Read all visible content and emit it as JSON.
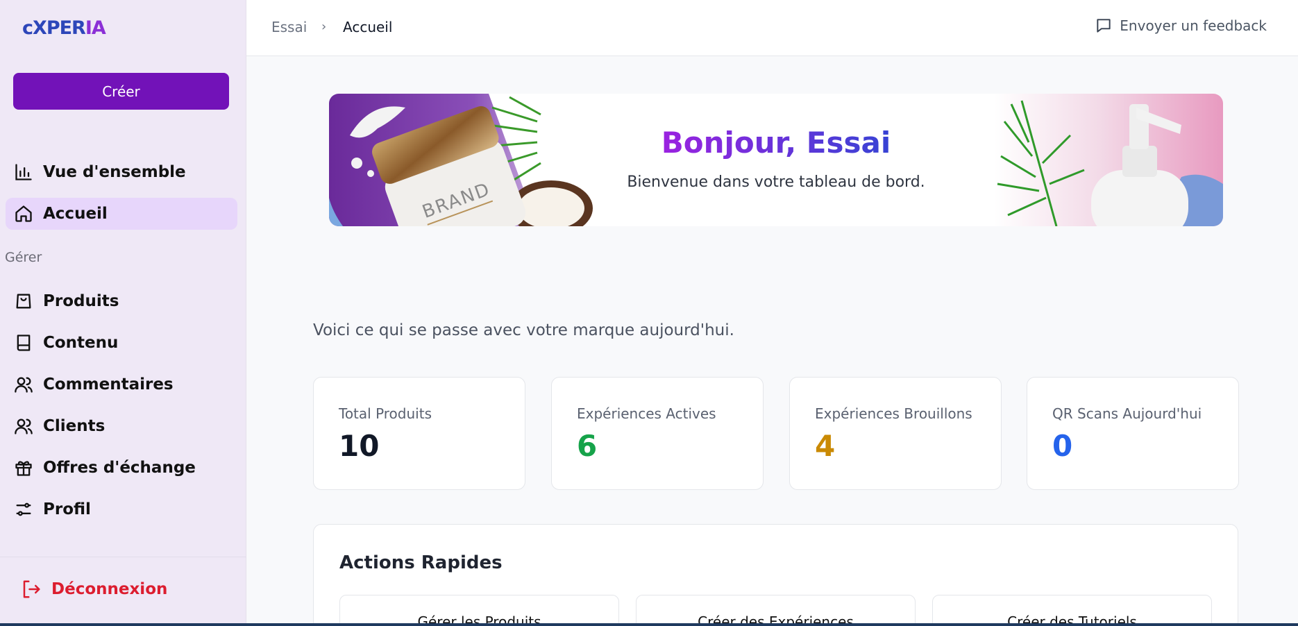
{
  "brand": {
    "logo_part1": "cXPER",
    "logo_part2": "IA"
  },
  "sidebar": {
    "create_label": "Créer",
    "items": [
      {
        "label": "Vue d'ensemble",
        "icon": "bar-chart-icon"
      },
      {
        "label": "Accueil",
        "icon": "home-icon",
        "active": true
      }
    ],
    "section_label": "Gérer",
    "manage_items": [
      {
        "label": "Produits",
        "icon": "shopping-bag-icon"
      },
      {
        "label": "Contenu",
        "icon": "book-icon"
      },
      {
        "label": "Commentaires",
        "icon": "users-icon"
      },
      {
        "label": "Clients",
        "icon": "users-icon"
      },
      {
        "label": "Offres d'échange",
        "icon": "gift-icon"
      },
      {
        "label": "Profil",
        "icon": "sliders-icon"
      }
    ],
    "logout_label": "Déconnexion"
  },
  "header": {
    "breadcrumb": [
      "Essai",
      "Accueil"
    ],
    "breadcrumb_separator": "›",
    "feedback_label": "Envoyer un feedback"
  },
  "banner": {
    "title": "Bonjour, Essai",
    "subtitle": "Bienvenue dans votre tableau de bord.",
    "jar_text": "BRAND"
  },
  "intro": "Voici ce qui se passe avec votre marque aujourd'hui.",
  "stats": [
    {
      "label": "Total Produits",
      "value": "10",
      "color": "#111827"
    },
    {
      "label": "Expériences Actives",
      "value": "6",
      "color": "#16a34a"
    },
    {
      "label": "Expériences Brouillons",
      "value": "4",
      "color": "#ca8a04"
    },
    {
      "label": "QR Scans Aujourd'hui",
      "value": "0",
      "color": "#2563eb"
    }
  ],
  "quick_actions": {
    "title": "Actions Rapides",
    "items": [
      "Gérer les Produits",
      "Créer des Expériences",
      "Créer des Tutoriels"
    ]
  },
  "colors": {
    "accent": "#7212b8",
    "active_bg": "#e7d6fb",
    "logout": "#dc1d2f"
  }
}
